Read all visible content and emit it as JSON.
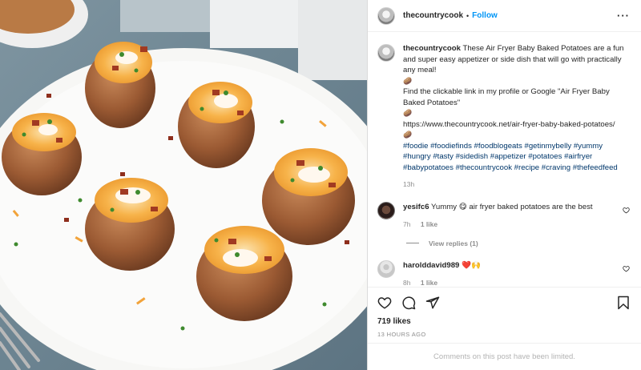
{
  "post": {
    "username": "thecountrycook",
    "follow_label": "Follow",
    "more_label": "···"
  },
  "caption": {
    "username": "thecountrycook",
    "text1": "These Air Fryer Baby Baked Potatoes are a fun and super easy appetizer or side dish that will go with practically any meal!",
    "emoji": "🥔",
    "text2": "Find the clickable link in my profile or Google \"Air Fryer Baby Baked Potatoes\"",
    "url": "https://www.thecountrycook.net/air-fryer-baby-baked-potatoes/",
    "hashtags": "#foodie #foodiefinds #foodblogeats #getinmybelly #yummy #hungry #tasty #sidedish #appetizer #potatoes #airfryer #babypotatoes #thecountrycook #recipe #craving #thefeedfeed",
    "time": "13h"
  },
  "comments": [
    {
      "username": "yesifc6",
      "text_before": "Yummy",
      "emoji": "😋",
      "text_after": "air fryer baked potatoes are the best",
      "time": "7h",
      "likes": "1 like",
      "view_replies": "View replies (1)"
    },
    {
      "username": "harolddavid989",
      "emoji": "❤️🙌",
      "time": "8h",
      "likes": "1 like"
    }
  ],
  "footer": {
    "likes": "719 likes",
    "ago": "13 HOURS AGO",
    "limited": "Comments on this post have been limited."
  },
  "icons": [
    "heart-icon",
    "comment-icon",
    "share-icon",
    "bookmark-icon",
    "more-icon"
  ],
  "colors": {
    "link": "#0095f6",
    "hashtag": "#00376b",
    "muted": "#8e8e8e",
    "heart_red": "#ed4956"
  }
}
